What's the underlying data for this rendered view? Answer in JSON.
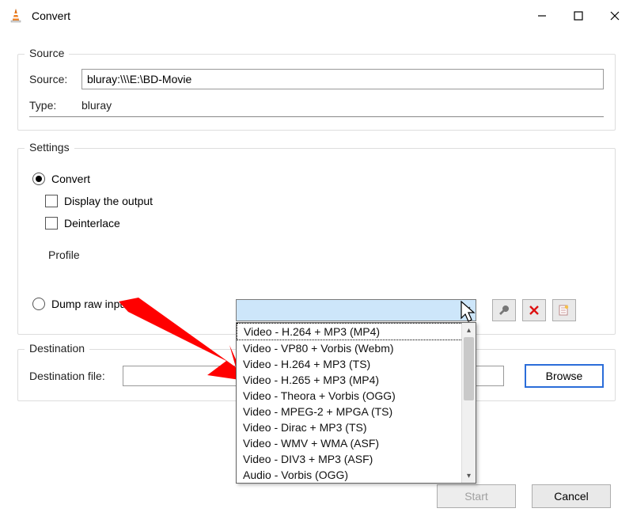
{
  "window": {
    "title": "Convert"
  },
  "source_group": {
    "legend": "Source",
    "source_label": "Source:",
    "source_value": "bluray:\\\\\\E:\\BD-Movie",
    "type_label": "Type:",
    "type_value": "bluray"
  },
  "settings_group": {
    "legend": "Settings",
    "convert_label": "Convert",
    "display_output_label": "Display the output",
    "deinterlace_label": "Deinterlace",
    "profile_label": "Profile",
    "dump_label": "Dump raw input"
  },
  "profile_options": [
    "Video - H.264 + MP3 (MP4)",
    "Video - VP80 + Vorbis (Webm)",
    "Video - H.264 + MP3 (TS)",
    "Video - H.265 + MP3 (MP4)",
    "Video - Theora + Vorbis (OGG)",
    "Video - MPEG-2 + MPGA (TS)",
    "Video - Dirac + MP3 (TS)",
    "Video - WMV + WMA (ASF)",
    "Video - DIV3 + MP3 (ASF)",
    "Audio - Vorbis (OGG)"
  ],
  "destination_group": {
    "legend": "Destination",
    "dest_file_label": "Destination file:",
    "browse_label": "Browse"
  },
  "buttons": {
    "start": "Start",
    "cancel": "Cancel"
  }
}
